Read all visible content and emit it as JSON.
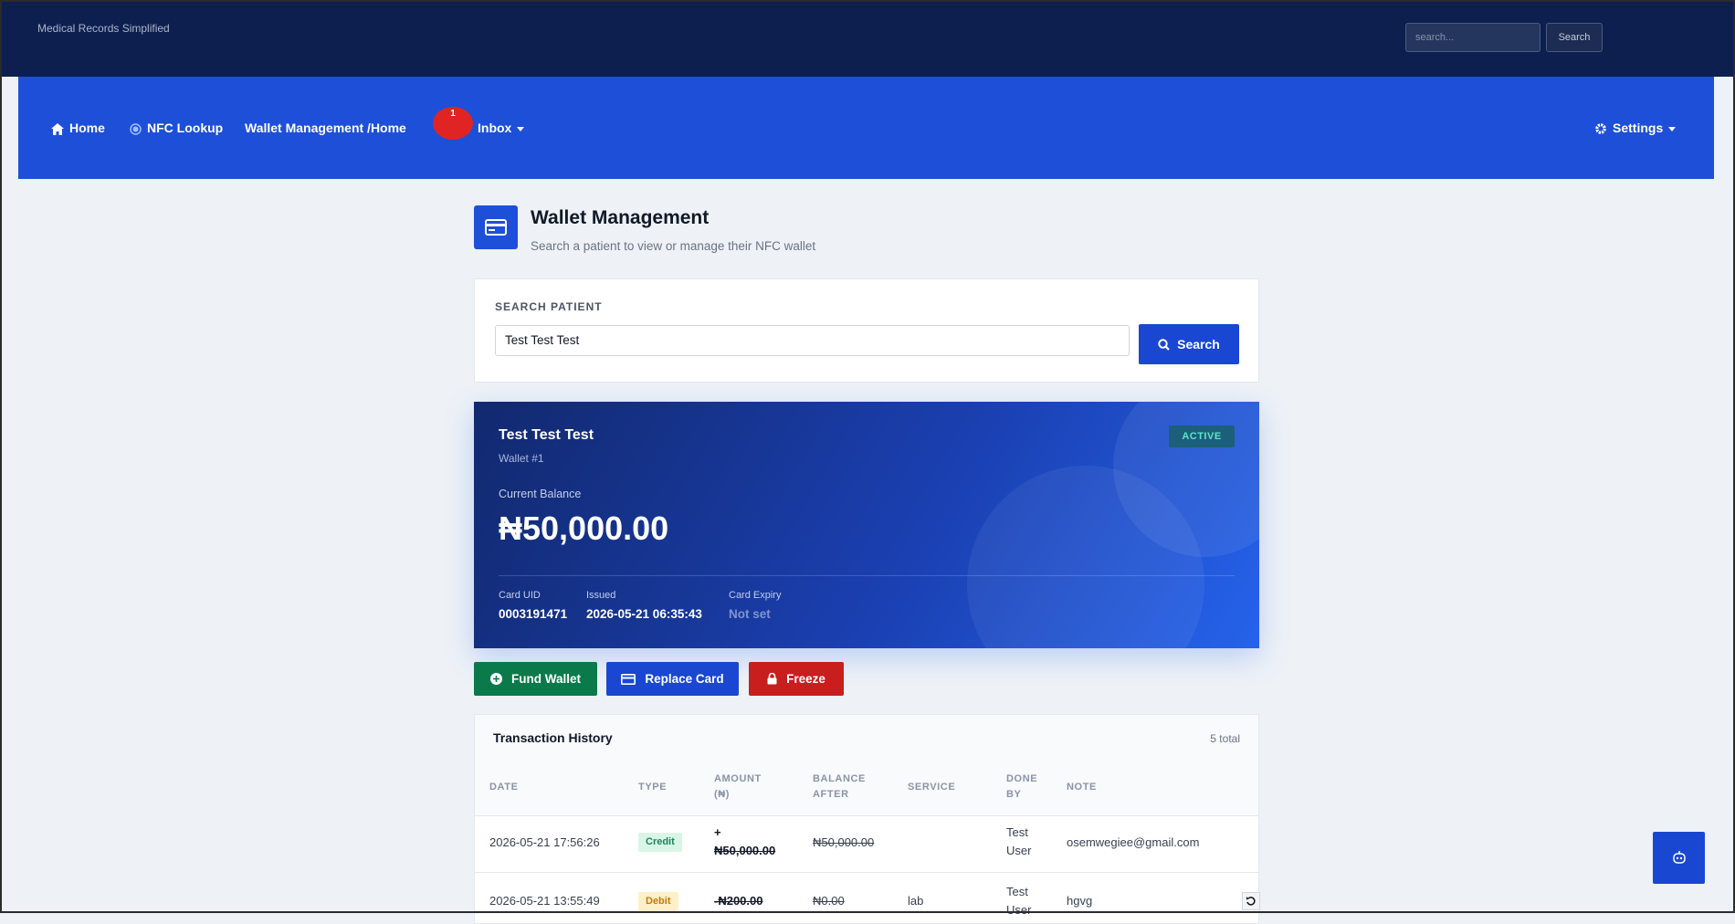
{
  "topbar": {
    "brand": "Medical Records Simplified",
    "search_placeholder": "search...",
    "search_button": "Search"
  },
  "nav": {
    "home": "Home",
    "nfc_lookup": "NFC Lookup",
    "wallet_management": "Wallet Management /Home",
    "inbox": "Inbox",
    "inbox_count": "1",
    "settings": "Settings"
  },
  "page": {
    "title": "Wallet Management",
    "subtitle": "Search a patient to view or manage their NFC wallet"
  },
  "search": {
    "label": "SEARCH PATIENT",
    "value": "Test Test Test",
    "button": "Search"
  },
  "wallet": {
    "name": "Test Test Test",
    "number": "Wallet #1",
    "status": "ACTIVE",
    "balance_label": "Current Balance",
    "balance": "₦50,000.00",
    "card_uid_label": "Card UID",
    "card_uid": "0003191471",
    "issued_label": "Issued",
    "issued": "2026-05-21 06:35:43",
    "expiry_label": "Card Expiry",
    "expiry": "Not set"
  },
  "actions": {
    "fund": "Fund Wallet",
    "replace": "Replace Card",
    "freeze": "Freeze"
  },
  "transactions": {
    "title": "Transaction History",
    "count": "5 total",
    "headers": {
      "date": "DATE",
      "type": "TYPE",
      "amount_1": "AMOUNT",
      "amount_2": "(₦)",
      "balance_1": "BALANCE",
      "balance_2": "AFTER",
      "service": "SERVICE",
      "done_1": "DONE",
      "done_2": "BY",
      "note": "NOTE"
    },
    "rows": [
      {
        "date": "2026-05-21 17:56:26",
        "type": "Credit",
        "amount_sign": "+",
        "amount": "₦50,000.00",
        "balance_after": "₦50,000.00",
        "service": "",
        "done_by_1": "Test",
        "done_by_2": "User",
        "note": "osemwegiee@gmail.com"
      },
      {
        "date": "2026-05-21 13:55:49",
        "type": "Debit",
        "amount": "-₦200.00",
        "balance_after": "₦0.00",
        "service": "lab",
        "done_by_1": "Test",
        "done_by_2": "User",
        "note": "hgvg"
      }
    ]
  },
  "colors": {
    "topbar": "#0d1f4f",
    "nav": "#1e4fd8",
    "fund": "#0b7a4b",
    "replace": "#1a47d2",
    "freeze": "#c81e1e"
  }
}
